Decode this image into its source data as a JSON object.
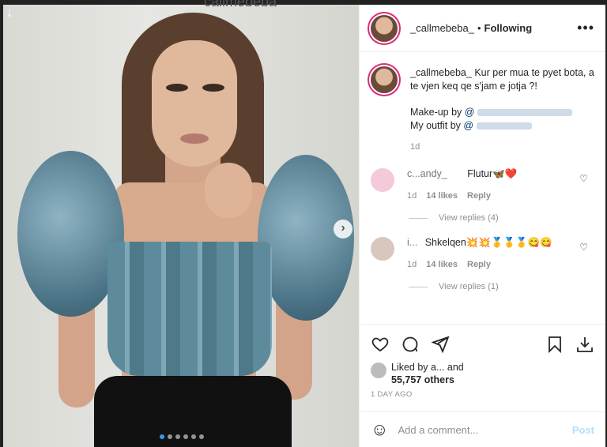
{
  "background_ghost_text": "callmebeba",
  "post": {
    "username": "_callmebeba_",
    "separator": "•",
    "follow_status": "Following",
    "more_icon": "more-horizontal-icon",
    "carousel": {
      "next_icon": "chevron-right-icon",
      "dot_count": 6,
      "active_index": 0
    }
  },
  "caption": {
    "username": "_callmebeba_",
    "text": " Kur per mua te pyet bota, a te vjen keq qe s'jam e jotja ?!",
    "makeup_label": "Make-up by ",
    "makeup_mention": "@",
    "outfit_label": "My outfit by ",
    "outfit_mention": "@",
    "time": "1d"
  },
  "comments": [
    {
      "username": "c...andy_",
      "text": "Flutur🦋❤️",
      "time": "1d",
      "likes": "14 likes",
      "reply": "Reply",
      "view_replies": "View replies (4)"
    },
    {
      "username": "i...",
      "text": "Shkelqen💥💥🥇🥇🥇😋😋",
      "time": "1d",
      "likes": "14 likes",
      "reply": "Reply",
      "view_replies": "View replies (1)"
    }
  ],
  "actions": {
    "like_icon": "heart-icon",
    "comment_icon": "comment-icon",
    "share_icon": "share-icon",
    "save_icon": "bookmark-icon",
    "download_icon": "download-icon"
  },
  "likes": {
    "prefix": "Liked by ",
    "user": "a...",
    "and": " and",
    "count": "55,757 others"
  },
  "posted_ago": "1 DAY AGO",
  "add_comment": {
    "placeholder": "Add a comment...",
    "post_label": "Post",
    "emoji_icon": "smile-icon"
  }
}
